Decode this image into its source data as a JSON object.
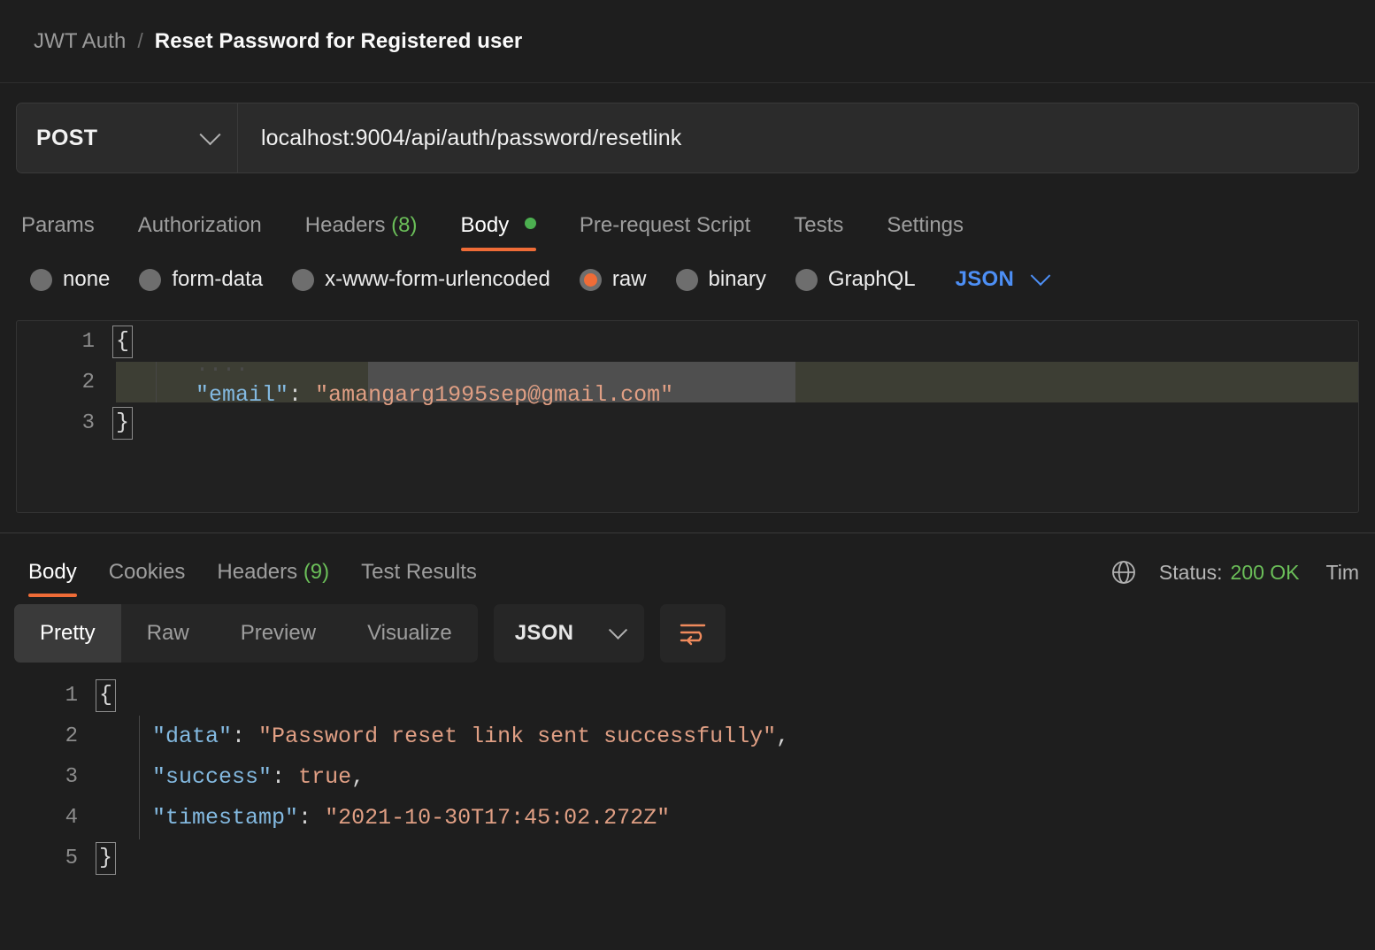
{
  "breadcrumb": {
    "collection": "JWT Auth",
    "separator": "/",
    "title": "Reset Password for Registered user"
  },
  "request": {
    "method": "POST",
    "url": "localhost:9004/api/auth/password/resetlink",
    "tabs": [
      {
        "label": "Params",
        "active": false
      },
      {
        "label": "Authorization",
        "active": false
      },
      {
        "label": "Headers",
        "count": "(8)",
        "active": false
      },
      {
        "label": "Body",
        "active": true,
        "dot": true
      },
      {
        "label": "Pre-request Script",
        "active": false
      },
      {
        "label": "Tests",
        "active": false
      },
      {
        "label": "Settings",
        "active": false
      }
    ],
    "body_types": [
      {
        "label": "none",
        "selected": false
      },
      {
        "label": "form-data",
        "selected": false
      },
      {
        "label": "x-www-form-urlencoded",
        "selected": false
      },
      {
        "label": "raw",
        "selected": true
      },
      {
        "label": "binary",
        "selected": false
      },
      {
        "label": "GraphQL",
        "selected": false
      }
    ],
    "raw_format": "JSON",
    "editor": {
      "line1_num": "1",
      "line1_brace": "{",
      "line2_num": "2",
      "line2_indent": "····",
      "line2_key": "\"email\"",
      "line2_colon": ": ",
      "line2_value": "\"amangarg1995sep@gmail.com\"",
      "line3_num": "3",
      "line3_brace": "}"
    }
  },
  "response": {
    "tabs": [
      {
        "label": "Body",
        "active": true
      },
      {
        "label": "Cookies",
        "active": false
      },
      {
        "label": "Headers",
        "count": "(9)",
        "active": false
      },
      {
        "label": "Test Results",
        "active": false
      }
    ],
    "status_label": "Status:",
    "status_value": "200 OK",
    "time_label": "Tim",
    "view_modes": [
      {
        "label": "Pretty",
        "active": true
      },
      {
        "label": "Raw",
        "active": false
      },
      {
        "label": "Preview",
        "active": false
      },
      {
        "label": "Visualize",
        "active": false
      }
    ],
    "format": "JSON",
    "body": {
      "line1_num": "1",
      "line1_brace": "{",
      "line2_num": "2",
      "line2_key": "\"data\"",
      "line2_colon": ": ",
      "line2_value": "\"Password reset link sent successfully\"",
      "line2_comma": ",",
      "line3_num": "3",
      "line3_key": "\"success\"",
      "line3_colon": ": ",
      "line3_value": "true",
      "line3_comma": ",",
      "line4_num": "4",
      "line4_key": "\"timestamp\"",
      "line4_colon": ": ",
      "line4_value": "\"2021-10-30T17:45:02.272Z\"",
      "line5_num": "5",
      "line5_brace": "}"
    }
  },
  "colors": {
    "accent": "#ef6c37",
    "success": "#6bbf59",
    "link": "#4d8ff5",
    "json_key": "#83b9e0",
    "json_string": "#e09f84",
    "editor_bg": "#212121",
    "active_line": "#3d3e34",
    "selection": "#4f4f4f"
  }
}
